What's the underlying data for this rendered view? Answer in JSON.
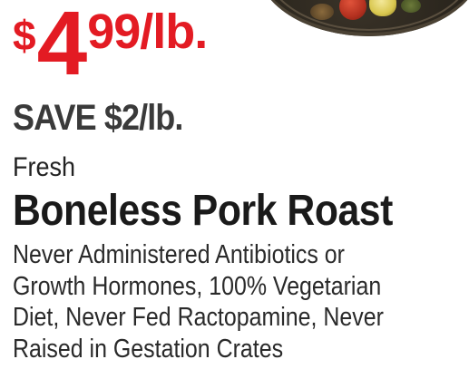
{
  "price": {
    "currency": "$",
    "dollars": "4",
    "cents": "99",
    "unit": "/lb."
  },
  "savings": "SAVE $2/lb.",
  "qualifier": "Fresh",
  "product_name": "Boneless Pork Roast",
  "description_lines": [
    "Never Administered Antibiotics or",
    "Growth Hormones, 100% Vegetarian",
    "Diet, Never Fed Ractopamine, Never",
    "Raised in Gestation Crates"
  ],
  "colors": {
    "price": "#e31b23",
    "savings": "#3a3a3a",
    "text": "#1a1a1a"
  }
}
